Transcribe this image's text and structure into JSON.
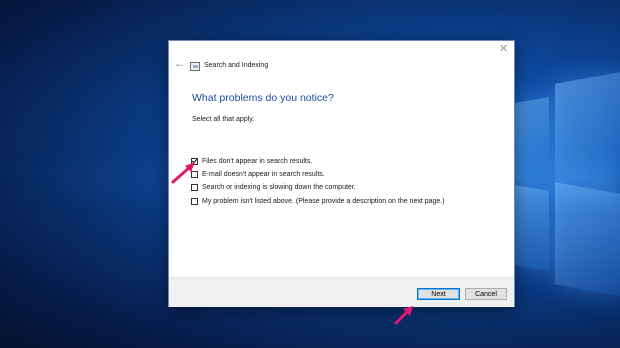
{
  "window": {
    "title": "Search and Indexing",
    "back_icon": "←",
    "close_icon": "✕"
  },
  "main": {
    "heading": "What problems do you notice?",
    "instruction": "Select all that apply."
  },
  "options": [
    {
      "label": "Files don't appear in search results.",
      "checked": true
    },
    {
      "label": "E-mail doesn't appear in search results.",
      "checked": false
    },
    {
      "label": "Search or indexing is slowing down the computer.",
      "checked": false
    },
    {
      "label": "My problem isn't listed above. (Please provide a description on the next page.)",
      "checked": false
    }
  ],
  "footer": {
    "next_label": "Next",
    "cancel_label": "Cancel"
  },
  "colors": {
    "heading": "#1d4c9c",
    "annotation_arrow": "#e5176b",
    "default_button_border": "#0078d7"
  }
}
